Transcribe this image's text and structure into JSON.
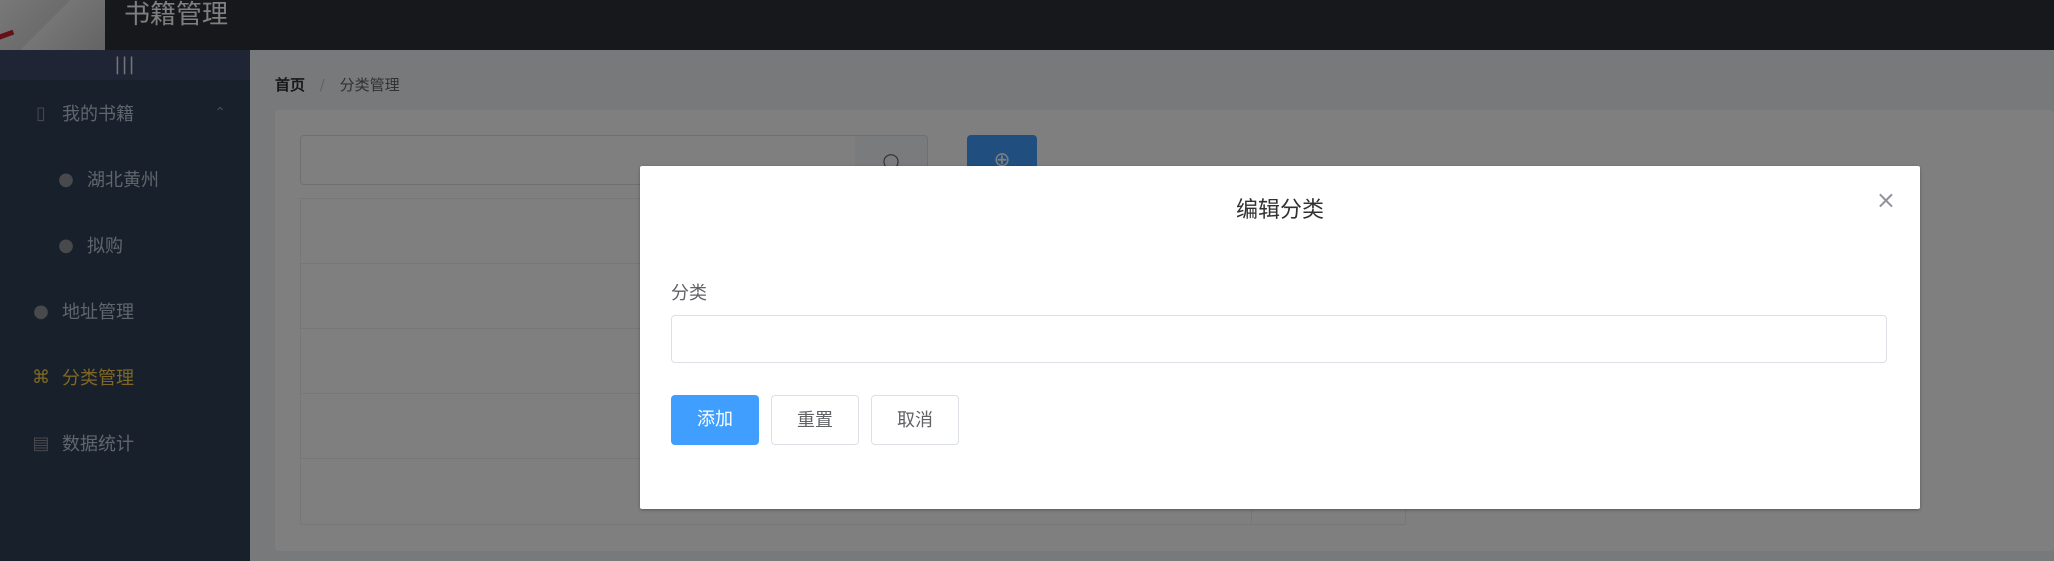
{
  "header": {
    "title": "书籍管理"
  },
  "sidebar": {
    "toggle_label": "|||",
    "items": [
      {
        "label": "我的书籍",
        "icon": "book-icon",
        "expanded": true
      },
      {
        "label": "湖北黄州",
        "icon": "location-icon",
        "sub": true
      },
      {
        "label": "拟购",
        "icon": "location-icon",
        "sub": true
      },
      {
        "label": "地址管理",
        "icon": "location-icon"
      },
      {
        "label": "分类管理",
        "icon": "paperclip-icon",
        "active": true
      },
      {
        "label": "数据统计",
        "icon": "document-icon"
      }
    ]
  },
  "breadcrumb": {
    "home": "首页",
    "separator": "/",
    "current": "分类管理"
  },
  "toolbar": {
    "search_placeholder": "",
    "search_icon": "search-icon",
    "add_icon": "plus-circle-icon"
  },
  "dialog": {
    "title": "编辑分类",
    "field_label": "分类",
    "field_value": "",
    "add_label": "添加",
    "reset_label": "重置",
    "cancel_label": "取消"
  },
  "colors": {
    "primary": "#409eff",
    "active_menu": "#ffd04b",
    "sidebar_bg": "#304156",
    "header_bg": "#2c3038"
  }
}
